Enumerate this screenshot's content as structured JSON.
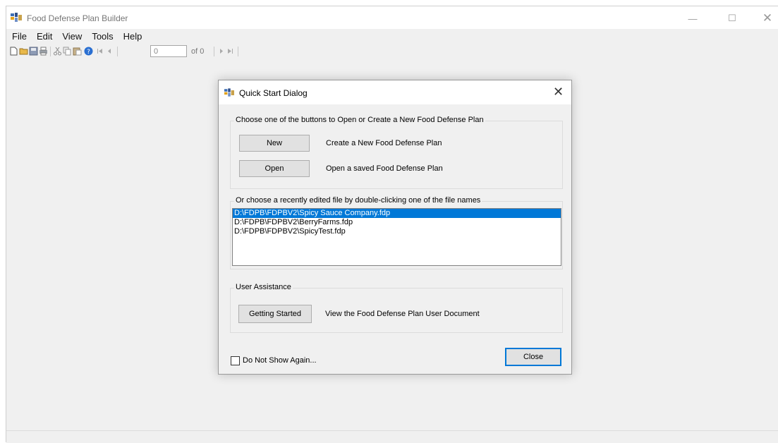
{
  "window": {
    "title": "Food Defense Plan Builder",
    "controls": {
      "minimize": "—",
      "maximize": "☐",
      "close": "✕"
    }
  },
  "menu": [
    "File",
    "Edit",
    "View",
    "Tools",
    "Help"
  ],
  "toolbar": {
    "icons": [
      "new-file-icon",
      "open-folder-icon",
      "save-icon",
      "print-icon",
      "cut-icon",
      "copy-icon",
      "paste-icon",
      "help-icon",
      "first-record-icon",
      "prev-record-icon",
      "next-record-icon",
      "last-record-icon"
    ],
    "position_value": "0",
    "of_label": "of 0"
  },
  "dialog": {
    "title": "Quick Start Dialog",
    "close_glyph": "✕",
    "open_create_group": {
      "legend": "Choose one of the buttons to Open or Create a New Food Defense Plan",
      "new_button": "New",
      "new_desc": "Create a New Food Defense Plan",
      "open_button": "Open",
      "open_desc": "Open a saved Food Defense Plan"
    },
    "recent_group": {
      "legend": "Or choose a recently edited file by double-clicking one of the file names",
      "files": [
        "D:\\FDPB\\FDPBV2\\Spicy Sauce Company.fdp",
        "D:\\FDPB\\FDPBV2\\BerryFarms.fdp",
        "D:\\FDPB\\FDPBV2\\SpicyTest.fdp"
      ],
      "selected_index": 0
    },
    "assist_group": {
      "legend": "User Assistance",
      "button": "Getting Started",
      "desc": "View the Food Defense Plan User Document"
    },
    "checkbox_label": "Do Not Show Again...",
    "checkbox_checked": false,
    "close_button": "Close"
  },
  "colors": {
    "selection": "#0078d7",
    "window_bg": "#f0f0f0",
    "button_bg": "#e1e1e1",
    "default_button_border": "#0078d7"
  }
}
